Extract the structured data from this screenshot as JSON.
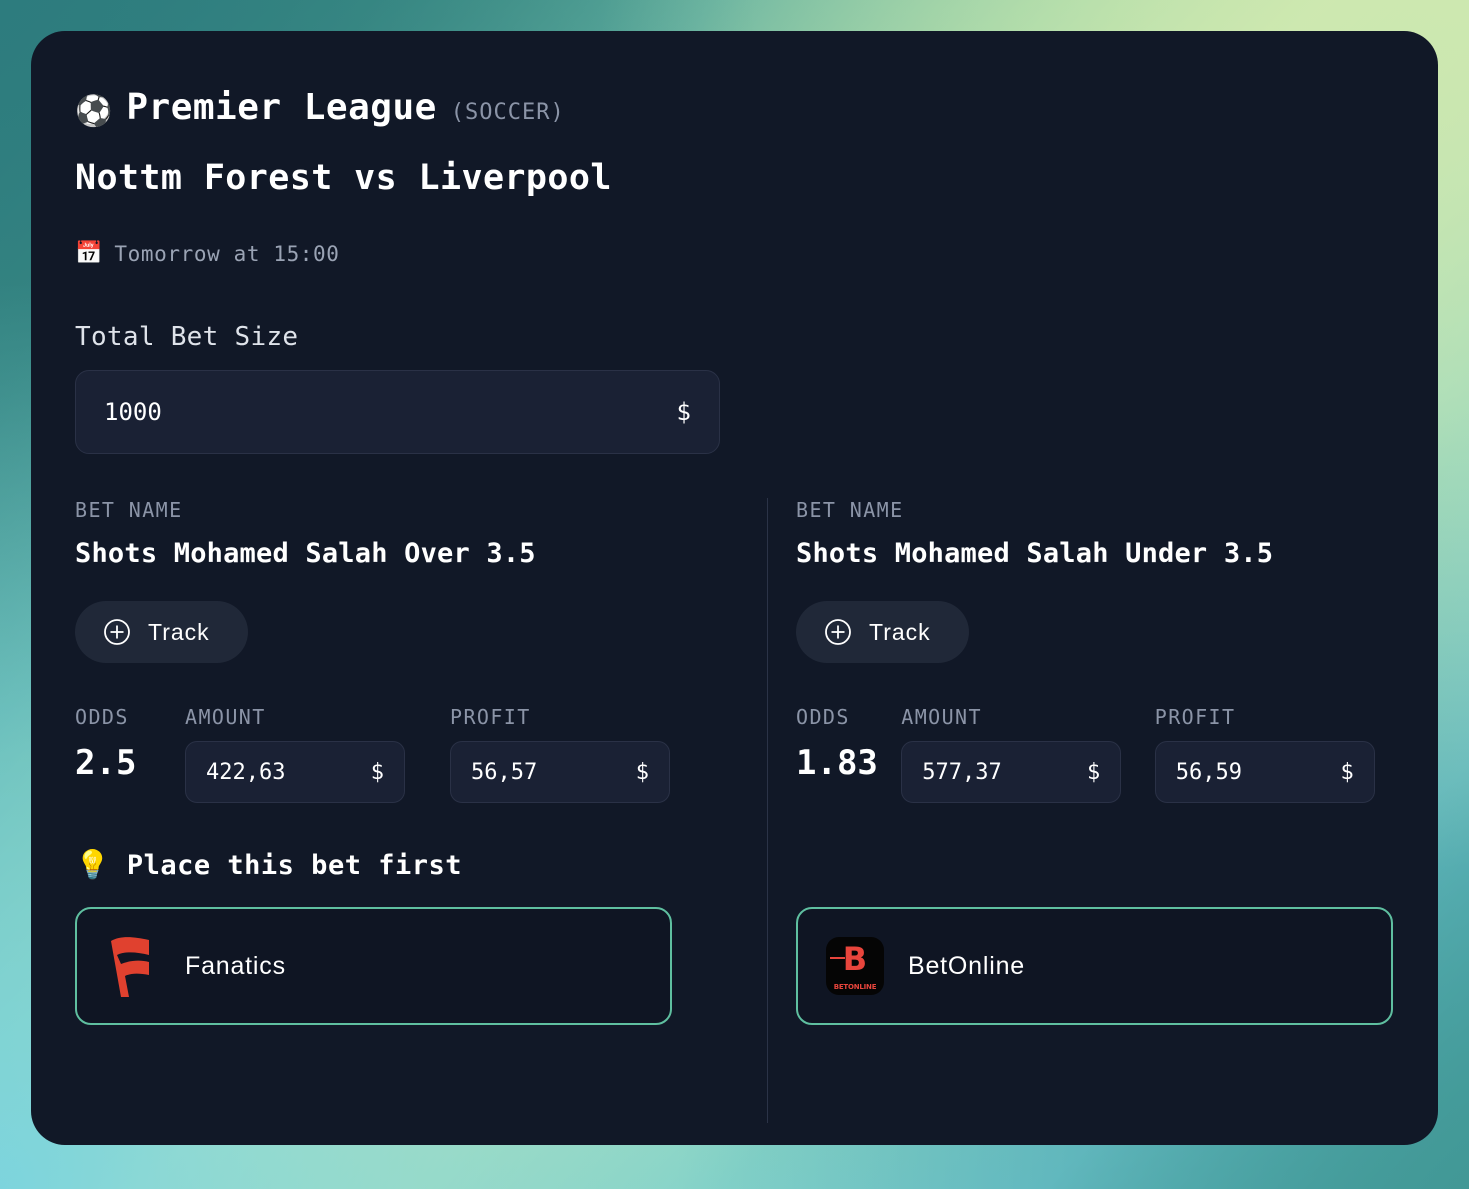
{
  "header": {
    "league_emoji": "⚽",
    "league_emoji_name": "soccer-ball-icon",
    "league_name": "Premier League",
    "sport": "(SOCCER)",
    "match_title": "Nottm Forest vs Liverpool",
    "calendar_emoji": "📅",
    "match_time": "Tomorrow at 15:00"
  },
  "total_bet": {
    "label": "Total Bet Size",
    "value": "1000",
    "placeholder": "1000",
    "currency": "$"
  },
  "labels": {
    "bet_name": "BET NAME",
    "odds": "ODDS",
    "amount": "AMOUNT",
    "profit": "PROFIT",
    "track": "Track",
    "currency": "$"
  },
  "hint": {
    "emoji": "💡",
    "text": "Place this bet first"
  },
  "legs": [
    {
      "bet_name": "Shots Mohamed Salah Over 3.5",
      "odds": "2.5",
      "amount": "422,63",
      "profit": "56,57",
      "bookmaker": "Fanatics",
      "has_hint": true
    },
    {
      "bet_name": "Shots Mohamed Salah Under 3.5",
      "odds": "1.83",
      "amount": "577,37",
      "profit": "56,59",
      "bookmaker": "BetOnline",
      "has_hint": false
    }
  ],
  "colors": {
    "card_bg": "#111827",
    "input_bg": "#1a2134",
    "accent_green": "#5fbfa0",
    "muted_text": "#8b94a7",
    "fanatics_red": "#e0412f",
    "betonline_red": "#e8453c"
  }
}
